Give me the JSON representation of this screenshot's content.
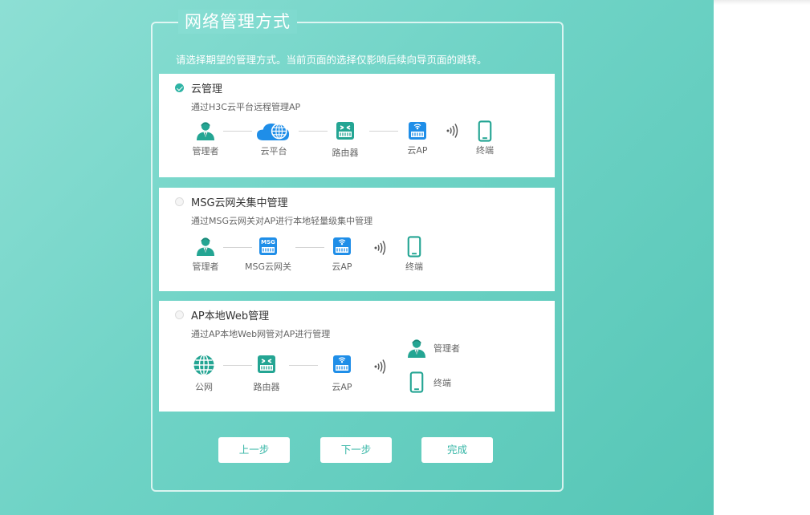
{
  "page": {
    "title": "网络管理方式",
    "hint": "请选择期望的管理方式。当前页面的选择仅影响后续向导页面的跳转。"
  },
  "colors": {
    "accent": "#2fb4a5",
    "icon_teal": "#24a593",
    "icon_blue": "#1f8ee8",
    "background_start": "#8ddfd4",
    "background_end": "#56c6b6"
  },
  "options": [
    {
      "title": "云管理",
      "selected": true,
      "desc": "通过H3C云平台远程管理AP",
      "nodes": [
        {
          "label": "管理者",
          "icon": "admin-icon"
        },
        {
          "label": "云平台",
          "icon": "cloud-platform-icon"
        },
        {
          "label": "路由器",
          "icon": "router-icon"
        },
        {
          "label": "云AP",
          "icon": "cloud-ap-icon"
        },
        {
          "label": "终端",
          "icon": "terminal-icon"
        }
      ]
    },
    {
      "title": "MSG云网关集中管理",
      "selected": false,
      "desc": "通过MSG云网关对AP进行本地轻量级集中管理",
      "nodes": [
        {
          "label": "管理者",
          "icon": "admin-icon"
        },
        {
          "label": "MSG云网关",
          "icon": "msg-gateway-icon",
          "badge": "MSG"
        },
        {
          "label": "云AP",
          "icon": "cloud-ap-icon"
        },
        {
          "label": "终端",
          "icon": "terminal-icon"
        }
      ]
    },
    {
      "title": "AP本地Web管理",
      "selected": false,
      "desc": "通过AP本地Web网管对AP进行管理",
      "nodes": [
        {
          "label": "公网",
          "icon": "globe-icon"
        },
        {
          "label": "路由器",
          "icon": "router-icon"
        },
        {
          "label": "云AP",
          "icon": "cloud-ap-icon"
        },
        {
          "label": "管理者",
          "icon": "admin-icon"
        },
        {
          "label": "终端",
          "icon": "terminal-icon"
        }
      ]
    }
  ],
  "buttons": {
    "prev": "上一步",
    "next": "下一步",
    "finish": "完成"
  }
}
